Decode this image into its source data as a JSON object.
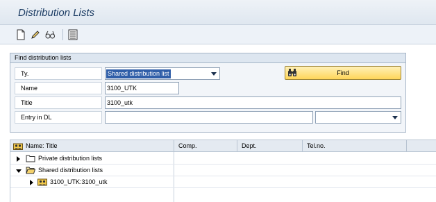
{
  "window": {
    "title": "Distribution Lists"
  },
  "toolbar": {
    "icons": [
      "new-document-icon",
      "edit-pencil-icon",
      "glasses-display-icon",
      "list-overview-icon"
    ]
  },
  "search": {
    "group_title": "Find distribution lists",
    "type_label": "Ty.",
    "type_value": "Shared distribution list",
    "name_label": "Name",
    "name_value": "3100_UTK",
    "title_label": "Title",
    "title_value": "3100_utk",
    "entry_label": "Entry in DL",
    "entry_value": "",
    "entry_type_value": "",
    "find_label": "Find"
  },
  "tree": {
    "columns": [
      "Name: Title",
      "Comp.",
      "Dept.",
      "Tel.no."
    ],
    "rows": [
      {
        "label": "Private distribution lists",
        "expanded": false,
        "icon": "folder-icon"
      },
      {
        "label": "Shared distribution lists",
        "expanded": true,
        "icon": "open-folder-icon"
      },
      {
        "label": "3100_UTK:3100_utk",
        "expanded": false,
        "icon": "group-users-icon"
      }
    ]
  },
  "colors": {
    "title_text": "#1f3f66",
    "find_button": "#ffd55a",
    "selection": "#2f5ea8"
  }
}
